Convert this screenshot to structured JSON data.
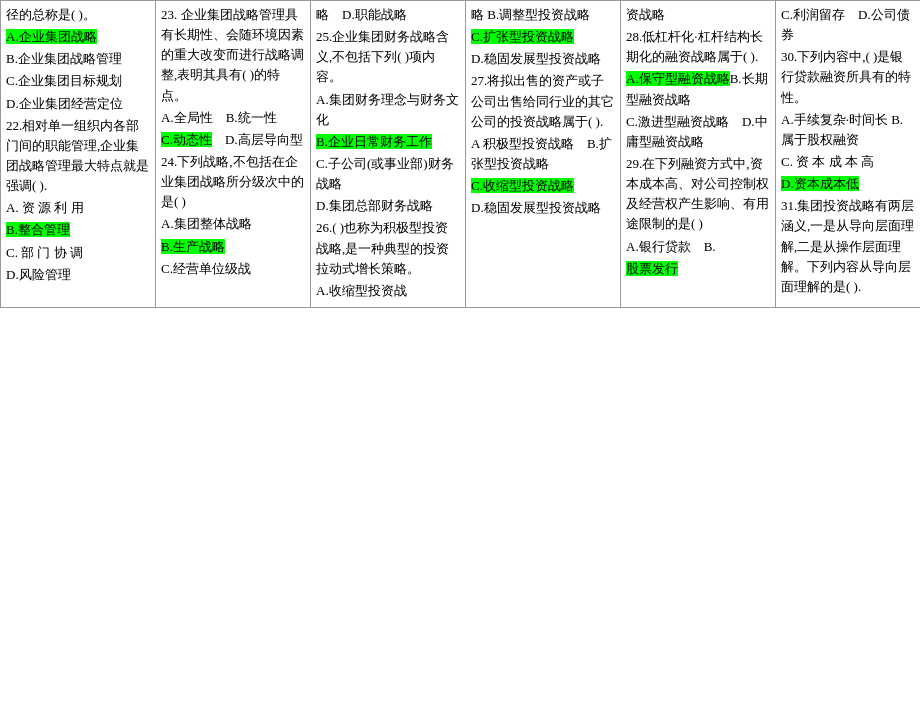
{
  "columns": [
    {
      "id": "col1",
      "content": [
        {
          "type": "text",
          "text": "径的总称是( )。"
        },
        {
          "type": "mixed",
          "parts": [
            {
              "hl": true,
              "text": "A.企业集团战略"
            },
            {
              "hl": false,
              "text": ""
            }
          ]
        },
        {
          "type": "text",
          "text": "B.企业集团战略管理"
        },
        {
          "type": "text",
          "text": "C.企业集团目标规划"
        },
        {
          "type": "text",
          "text": "D.企业集团经营定位"
        },
        {
          "type": "text",
          "text": "22.相对单一组织内各部门间的职能管理,企业集团战略管理最大特点就是强调( )."
        },
        {
          "type": "text",
          "text": "A. 资 源 利 用"
        },
        {
          "type": "mixed",
          "parts": [
            {
              "hl": true,
              "text": "B.整合管理"
            },
            {
              "hl": false,
              "text": ""
            }
          ]
        },
        {
          "type": "text",
          "text": "C. 部 门 协 调"
        },
        {
          "type": "text",
          "text": "D.风险管理"
        }
      ]
    },
    {
      "id": "col2",
      "content": [
        {
          "type": "text",
          "text": "23. 企业集团战略管理具有长期性、会随环境因素的重大改变而进行战略调整,表明其具有( )的特点。"
        },
        {
          "type": "text",
          "text": "A.全局性　B.统一性"
        },
        {
          "type": "mixed",
          "parts": [
            {
              "hl": true,
              "text": "C.动态性"
            },
            {
              "hl": false,
              "text": "　D.高层导向型"
            }
          ]
        },
        {
          "type": "text",
          "text": "24.下列战略,不包括在企业集团战略所分级次中的是( )"
        },
        {
          "type": "text",
          "text": "A.集团整体战略"
        },
        {
          "type": "mixed",
          "parts": [
            {
              "hl": true,
              "text": "B.生产战略"
            },
            {
              "hl": false,
              "text": ""
            }
          ]
        },
        {
          "type": "text",
          "text": "C.经营单位级战"
        }
      ]
    },
    {
      "id": "col3",
      "content": [
        {
          "type": "text",
          "text": "略　D.职能战略"
        },
        {
          "type": "text",
          "text": "25.企业集团财务战略含义,不包括下列( )项内容。"
        },
        {
          "type": "text",
          "text": "A.集团财务理念与财务文化"
        },
        {
          "type": "mixed",
          "parts": [
            {
              "hl": true,
              "text": "B.企业日常财务工作"
            },
            {
              "hl": false,
              "text": ""
            }
          ]
        },
        {
          "type": "text",
          "text": "C.子公司(或事业部)财务战略"
        },
        {
          "type": "text",
          "text": "D.集团总部财务战略"
        },
        {
          "type": "text",
          "text": "26.( )也称为积极型投资战略,是一种典型的投资拉动式增长策略。"
        },
        {
          "type": "text",
          "text": "A.收缩型投资战"
        }
      ]
    },
    {
      "id": "col4",
      "content": [
        {
          "type": "text",
          "text": "略 B.调整型投资战略"
        },
        {
          "type": "mixed",
          "parts": [
            {
              "hl": true,
              "text": "C.扩张型投资战略"
            },
            {
              "hl": false,
              "text": ""
            }
          ]
        },
        {
          "type": "text",
          "text": "D.稳固发展型投资战略"
        },
        {
          "type": "text",
          "text": "27.将拟出售的资产或子公司出售给同行业的其它公司的投资战略属于( )."
        },
        {
          "type": "text",
          "text": "A 积极型投资战略　B.扩张型投资战略"
        },
        {
          "type": "mixed",
          "parts": [
            {
              "hl": true,
              "text": "C.收缩型投资战略"
            },
            {
              "hl": false,
              "text": ""
            }
          ]
        },
        {
          "type": "text",
          "text": "D.稳固发展型投资战略"
        }
      ]
    },
    {
      "id": "col5",
      "content": [
        {
          "type": "text",
          "text": "资战略"
        },
        {
          "type": "text",
          "text": "28.低杠杆化·杠杆结构长期化的融资战略属于( )."
        },
        {
          "type": "mixed",
          "parts": [
            {
              "hl": true,
              "text": "A.保守型融资战略"
            },
            {
              "hl": false,
              "text": "B.长期型融资战略"
            }
          ]
        },
        {
          "type": "text",
          "text": "C.激进型融资战略　D.中庸型融资战略"
        },
        {
          "type": "text",
          "text": "29.在下列融资方式中,资本成本高、对公司控制权及经营权产生影响、有用途限制的是( )"
        },
        {
          "type": "text",
          "text": "A.银行贷款　B."
        },
        {
          "type": "mixed",
          "parts": [
            {
              "hl": true,
              "text": "股票发行"
            },
            {
              "hl": false,
              "text": ""
            }
          ]
        }
      ]
    },
    {
      "id": "col6",
      "content": [
        {
          "type": "text",
          "text": "C.利润留存　D.公司债券"
        },
        {
          "type": "text",
          "text": "30.下列内容中,( )是银行贷款融资所具有的特性。"
        },
        {
          "type": "text",
          "text": "A.手续复杂·时间长 B.属于股权融资"
        },
        {
          "type": "text",
          "text": "C. 资 本 成 本 高"
        },
        {
          "type": "mixed",
          "parts": [
            {
              "hl": true,
              "text": "D.资本成本低"
            },
            {
              "hl": false,
              "text": ""
            }
          ]
        },
        {
          "type": "text",
          "text": "31.集团投资战略有两层涵义,一是从导向层面理解,二是从操作层面理解。下列内容从导向层面理解的是( )."
        }
      ]
    }
  ]
}
